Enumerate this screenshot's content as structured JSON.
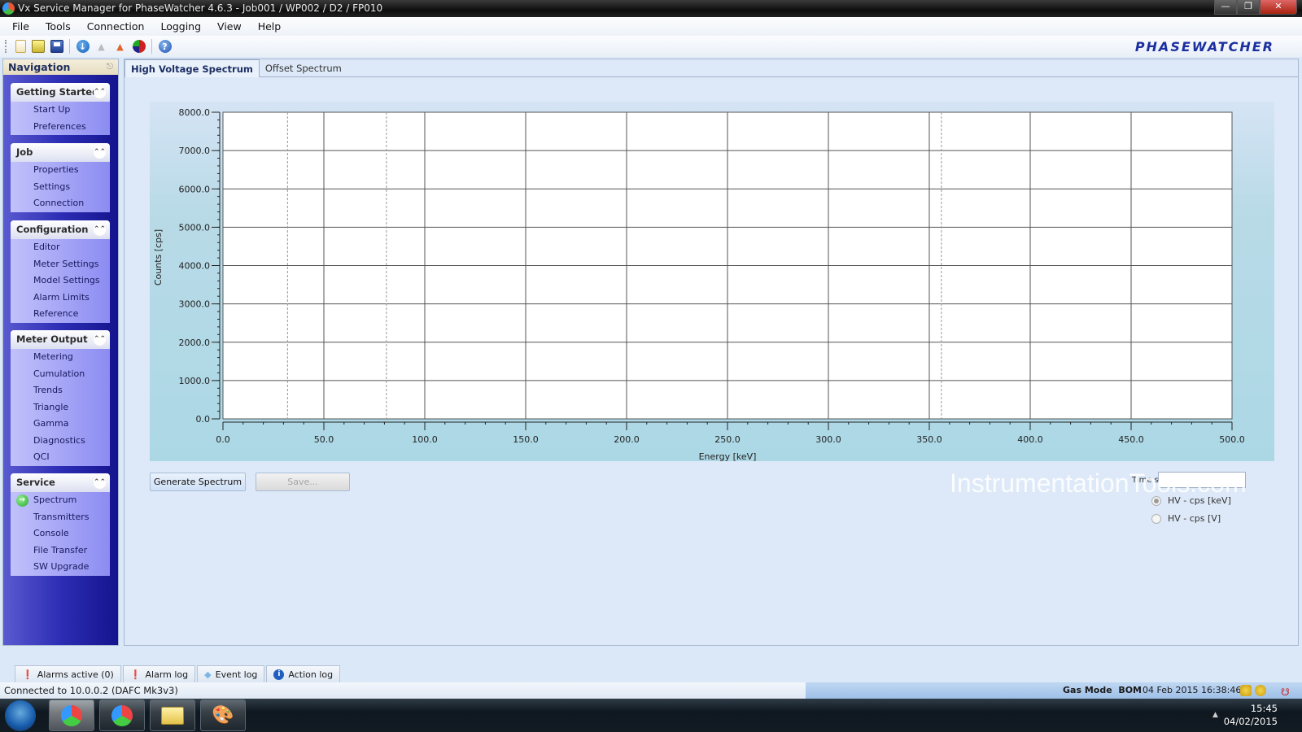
{
  "window": {
    "title": "Vx Service Manager for PhaseWatcher 4.6.3 - Job001 / WP002 / D2 / FP010",
    "brand": "PhaseWatcher"
  },
  "menu": [
    "File",
    "Tools",
    "Connection",
    "Logging",
    "View",
    "Help"
  ],
  "toolbar": {
    "icons": [
      "new-document-icon",
      "open-folder-icon",
      "save-disk-icon",
      "download-icon",
      "disabled-transmitter-icon",
      "upload-transmitter-icon",
      "sync-icon",
      "help-icon"
    ]
  },
  "navigation": {
    "title": "Navigation",
    "groups": [
      {
        "title": "Getting Started",
        "items": [
          "Start Up",
          "Preferences"
        ]
      },
      {
        "title": "Job",
        "items": [
          "Properties",
          "Settings",
          "Connection"
        ]
      },
      {
        "title": "Configuration",
        "items": [
          "Editor",
          "Meter Settings",
          "Model Settings",
          "Alarm Limits",
          "Reference"
        ]
      },
      {
        "title": "Meter Output",
        "items": [
          "Metering",
          "Cumulation",
          "Trends",
          "Triangle",
          "Gamma",
          "Diagnostics",
          "QCI"
        ]
      },
      {
        "title": "Service",
        "items": [
          "Spectrum",
          "Transmitters",
          "Console",
          "File Transfer",
          "SW Upgrade"
        ],
        "active_item": "Spectrum"
      }
    ]
  },
  "tabs": [
    {
      "label": "High Voltage Spectrum",
      "active": true
    },
    {
      "label": "Offset Spectrum",
      "active": false
    }
  ],
  "chart_data": {
    "type": "line",
    "title": "",
    "xlabel": "Energy [keV]",
    "ylabel": "Counts [cps]",
    "xlim": [
      0,
      500
    ],
    "ylim": [
      0,
      8000
    ],
    "x_ticks": [
      "0.0",
      "50.0",
      "100.0",
      "150.0",
      "200.0",
      "250.0",
      "300.0",
      "350.0",
      "400.0",
      "450.0",
      "500.0"
    ],
    "y_ticks": [
      "0.0",
      "1000.0",
      "2000.0",
      "3000.0",
      "4000.0",
      "5000.0",
      "6000.0",
      "7000.0",
      "8000.0"
    ],
    "x_tick_values": [
      0,
      50,
      100,
      150,
      200,
      250,
      300,
      350,
      400,
      450,
      500
    ],
    "y_tick_values": [
      0,
      1000,
      2000,
      3000,
      4000,
      5000,
      6000,
      7000,
      8000
    ],
    "x_minor_step": 10,
    "y_minor_step": 200,
    "grid": true,
    "markers_keV": [
      32,
      81,
      356
    ],
    "series": []
  },
  "actions": {
    "generate": "Generate Spectrum",
    "save": "Save..."
  },
  "timestamp": {
    "label": "Time stamp",
    "value": ""
  },
  "radio_options": [
    {
      "label": "HV - cps [keV]",
      "selected": true
    },
    {
      "label": "HV - cps [V]",
      "selected": false
    }
  ],
  "watermark": "InstrumentationTools.com",
  "log_tabs": [
    "Alarms active (0)",
    "Alarm log",
    "Event log",
    "Action log"
  ],
  "status": {
    "connection": "Connected to 10.0.0.2 (DAFC Mk3v3)",
    "mode": "Gas Mode  BOM",
    "datetime": "04 Feb 2015 16:38:46"
  },
  "taskbar": {
    "time": "15:45",
    "date": "04/02/2015"
  }
}
